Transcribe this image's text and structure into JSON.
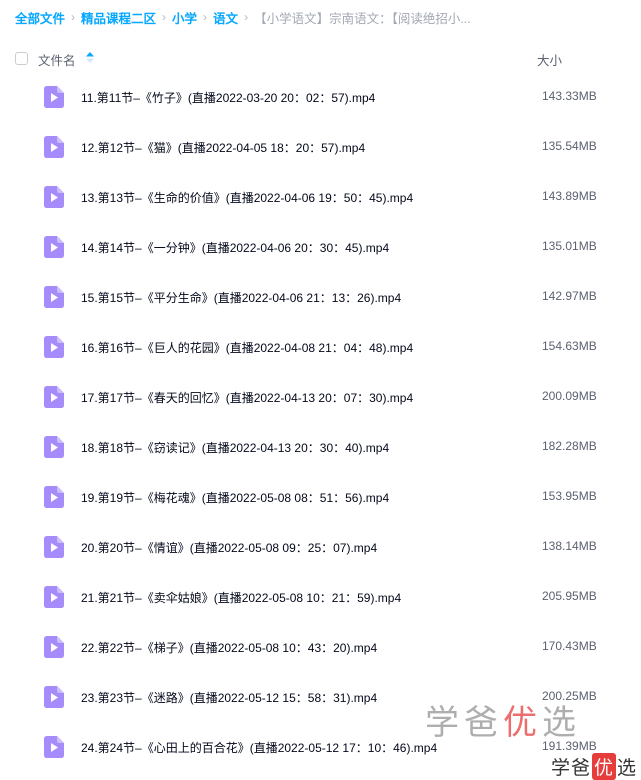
{
  "breadcrumb": {
    "items": [
      "全部文件",
      "精品课程二区",
      "小学",
      "语文"
    ],
    "current": "【小学语文】宗南语文：【阅读绝招小..."
  },
  "header": {
    "name_label": "文件名",
    "size_label": "大小"
  },
  "files": [
    {
      "name": "11.第11节–《竹子》(直播2022-03-20 20：02：57).mp4",
      "size": "143.33MB"
    },
    {
      "name": "12.第12节–《猫》(直播2022-04-05 18：20：57).mp4",
      "size": "135.54MB"
    },
    {
      "name": "13.第13节–《生命的价值》(直播2022-04-06 19：50：45).mp4",
      "size": "143.89MB"
    },
    {
      "name": "14.第14节–《一分钟》(直播2022-04-06 20：30：45).mp4",
      "size": "135.01MB"
    },
    {
      "name": "15.第15节–《平分生命》(直播2022-04-06 21：13：26).mp4",
      "size": "142.97MB"
    },
    {
      "name": "16.第16节–《巨人的花园》(直播2022-04-08 21：04：48).mp4",
      "size": "154.63MB"
    },
    {
      "name": "17.第17节–《春天的回忆》(直播2022-04-13 20：07：30).mp4",
      "size": "200.09MB"
    },
    {
      "name": "18.第18节–《窃读记》(直播2022-04-13 20：30：40).mp4",
      "size": "182.28MB"
    },
    {
      "name": "19.第19节–《梅花魂》(直播2022-05-08 08：51：56).mp4",
      "size": "153.95MB"
    },
    {
      "name": "20.第20节–《情谊》(直播2022-05-08 09：25：07).mp4",
      "size": "138.14MB"
    },
    {
      "name": "21.第21节–《卖伞姑娘》(直播2022-05-08 10：21：59).mp4",
      "size": "205.95MB"
    },
    {
      "name": "22.第22节–《梯子》(直播2022-05-08 10：43：20).mp4",
      "size": "170.43MB"
    },
    {
      "name": "23.第23节–《迷路》(直播2022-05-12 15：58：31).mp4",
      "size": "200.25MB"
    },
    {
      "name": "24.第24节–《心田上的百合花》(直播2022-05-12 17：10：46).mp4",
      "size": "191.39MB"
    }
  ],
  "icons": {
    "file": "video-file-icon",
    "sort": "sort-ascending-icon"
  },
  "colors": {
    "link": "#06a7ff",
    "file_icon": "#a68bfb",
    "sort_active": "#06a7ff"
  },
  "watermark": {
    "large": [
      "学",
      "爸",
      "优",
      "选"
    ],
    "small": [
      "学",
      "爸",
      "优",
      "选"
    ]
  }
}
